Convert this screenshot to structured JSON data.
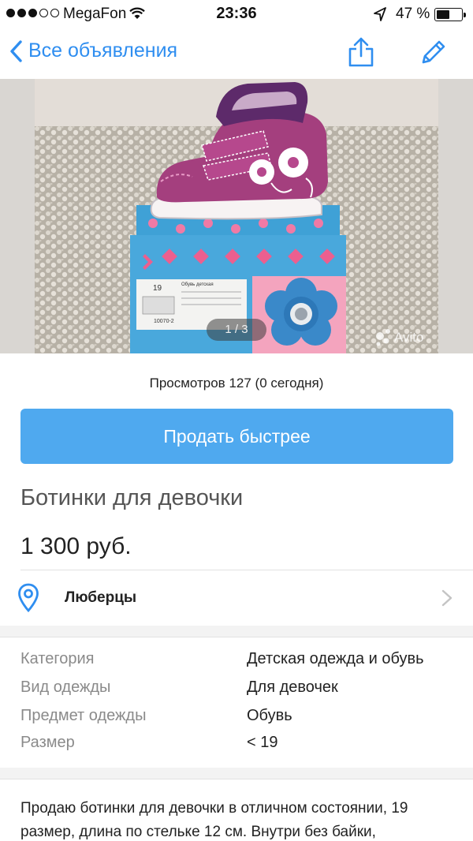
{
  "status_bar": {
    "carrier": "MegaFon",
    "time": "23:36",
    "battery": "47 %",
    "battery_level": 0.47
  },
  "nav": {
    "back_label": "Все объявления",
    "accent_color": "#2f8ef0"
  },
  "gallery": {
    "counter": "1 / 3",
    "watermark": "Avito",
    "box_label_size": "19",
    "box_label_title": "Обувь детская",
    "box_label_code": "10070-2"
  },
  "stats": {
    "views": "Просмотров 127 (0 сегодня)"
  },
  "actions": {
    "sell_faster": "Продать быстрее",
    "button_color": "#4fa9ef"
  },
  "ad": {
    "title": "Ботинки для девочки",
    "price": "1 300 руб.",
    "city": "Люберцы"
  },
  "params": [
    {
      "name": "Категория",
      "value": "Детская одежда и обувь"
    },
    {
      "name": "Вид одежды",
      "value": "Для девочек"
    },
    {
      "name": "Предмет одежды",
      "value": "Обувь"
    },
    {
      "name": "Размер",
      "value": "< 19"
    }
  ],
  "description": "Продаю ботинки для девочки в отличном состоянии, 19 размер, длина по стельке 12 см. Внутри без байки,"
}
